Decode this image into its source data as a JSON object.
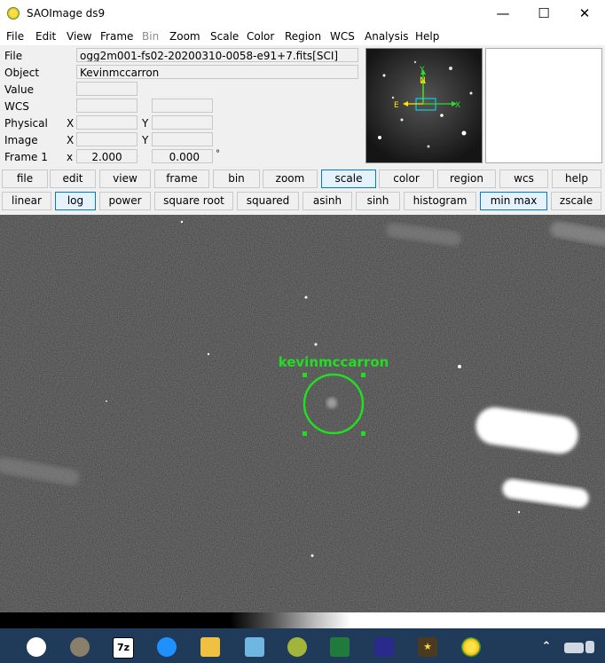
{
  "window": {
    "title": "SAOImage ds9"
  },
  "menu": [
    "File",
    "Edit",
    "View",
    "Frame",
    "Bin",
    "Zoom",
    "Scale",
    "Color",
    "Region",
    "WCS",
    "Analysis",
    "Help"
  ],
  "info": {
    "file_label": "File",
    "file_value": "ogg2m001-fs02-20200310-0058-e91+7.fits[SCI]",
    "object_label": "Object",
    "object_value": "Kevinmccarron",
    "value_label": "Value",
    "wcs_label": "WCS",
    "physical_label": "Physical",
    "image_label": "Image",
    "frame_label": "Frame 1",
    "x_label": "X",
    "y_label": "Y",
    "x_small": "x",
    "zoom_value": "2.000",
    "angle_value": "0.000",
    "angle_symbol": "°"
  },
  "panner": {
    "north": "N",
    "east": "E",
    "x_axis": "X",
    "y_axis": "Y"
  },
  "buttons_row1": [
    "file",
    "edit",
    "view",
    "frame",
    "bin",
    "zoom",
    "scale",
    "color",
    "region",
    "wcs",
    "help"
  ],
  "buttons_row2": [
    "linear",
    "log",
    "power",
    "square root",
    "squared",
    "asinh",
    "sinh",
    "histogram",
    "min max",
    "zscale"
  ],
  "region": {
    "label": "kevinmccarron",
    "color": "#22dd22"
  },
  "taskbar": {
    "zip_label": "7z"
  }
}
